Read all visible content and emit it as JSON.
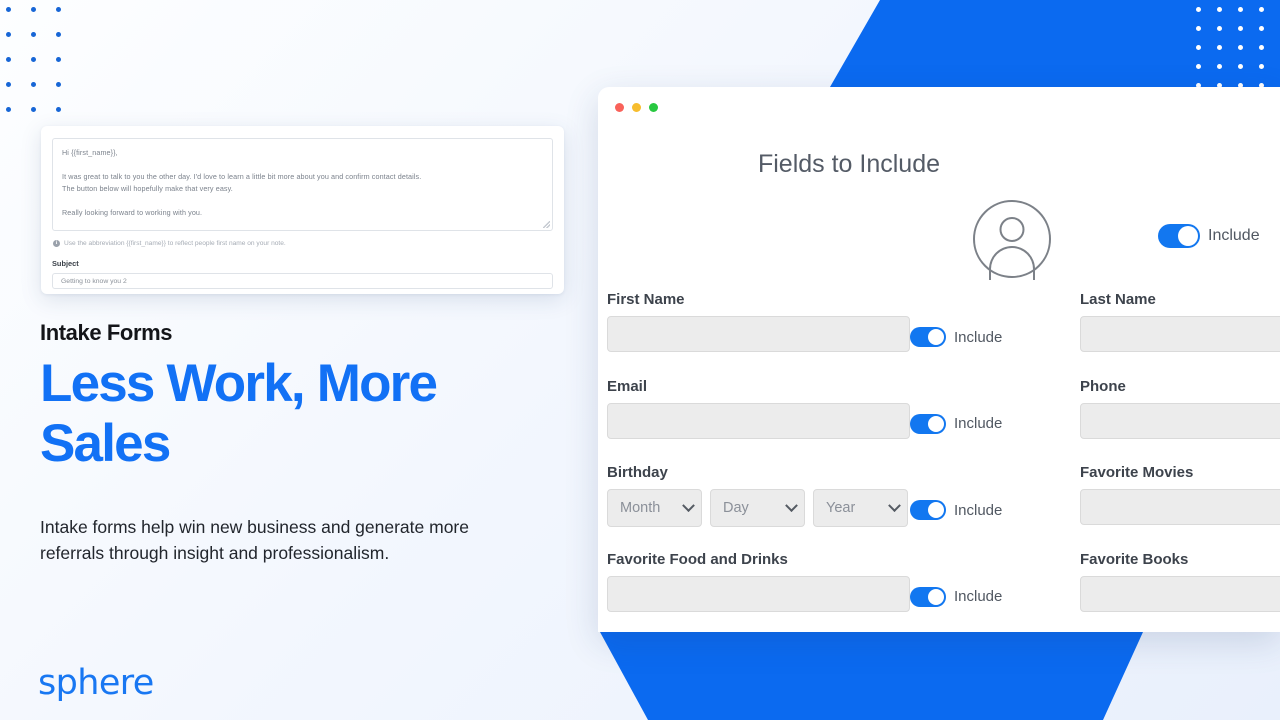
{
  "brand": {
    "logo_text": "sphere",
    "accent": "#1271f5",
    "blue_shape": "#0b6af0"
  },
  "marketing": {
    "eyebrow": "Intake Forms",
    "headline_line1": "Less Work, More",
    "headline_line2": "Sales",
    "subcopy": "Intake forms help win new business and generate more referrals through insight and professionalism."
  },
  "email_editor": {
    "body_line1": "Hi {{first_name}},",
    "body_line2": "It was great to talk to you the other day. I'd love to learn a little bit more about you and confirm contact details.",
    "body_line3": "The button below will hopefully make that very easy.",
    "body_line4": "Really looking forward to working with you.",
    "hint": "Use the abbreviation {{first_name}} to reflect people first name on your note.",
    "subject_label": "Subject",
    "subject_value": "Getting to know you 2"
  },
  "window": {
    "traffic_lights": [
      "close",
      "minimize",
      "maximize"
    ],
    "panel_title": "Fields to Include",
    "avatar_toggle": {
      "label": "Include",
      "on": true
    }
  },
  "form": {
    "toggle_label": "Include",
    "rows": [
      {
        "left": {
          "label": "First Name",
          "value": "",
          "type": "text"
        },
        "toggle": {
          "label": "Include",
          "on": true
        },
        "right": {
          "label": "Last Name",
          "value": "",
          "type": "text"
        }
      },
      {
        "left": {
          "label": "Email",
          "value": "",
          "type": "text"
        },
        "toggle": {
          "label": "Include",
          "on": true
        },
        "right": {
          "label": "Phone",
          "value": "",
          "type": "text"
        }
      },
      {
        "left": {
          "label": "Birthday",
          "type": "date",
          "selects": [
            {
              "value": "Month",
              "name": "month-select"
            },
            {
              "value": "Day",
              "name": "day-select"
            },
            {
              "value": "Year",
              "name": "year-select"
            }
          ]
        },
        "toggle": {
          "label": "Include",
          "on": true
        },
        "right": {
          "label": "Favorite Movies",
          "value": "",
          "type": "text"
        }
      },
      {
        "left": {
          "label": "Favorite Food and Drinks",
          "value": "",
          "type": "text"
        },
        "toggle": {
          "label": "Include",
          "on": true
        },
        "right": {
          "label": "Favorite Books",
          "value": "",
          "type": "text"
        }
      }
    ]
  }
}
